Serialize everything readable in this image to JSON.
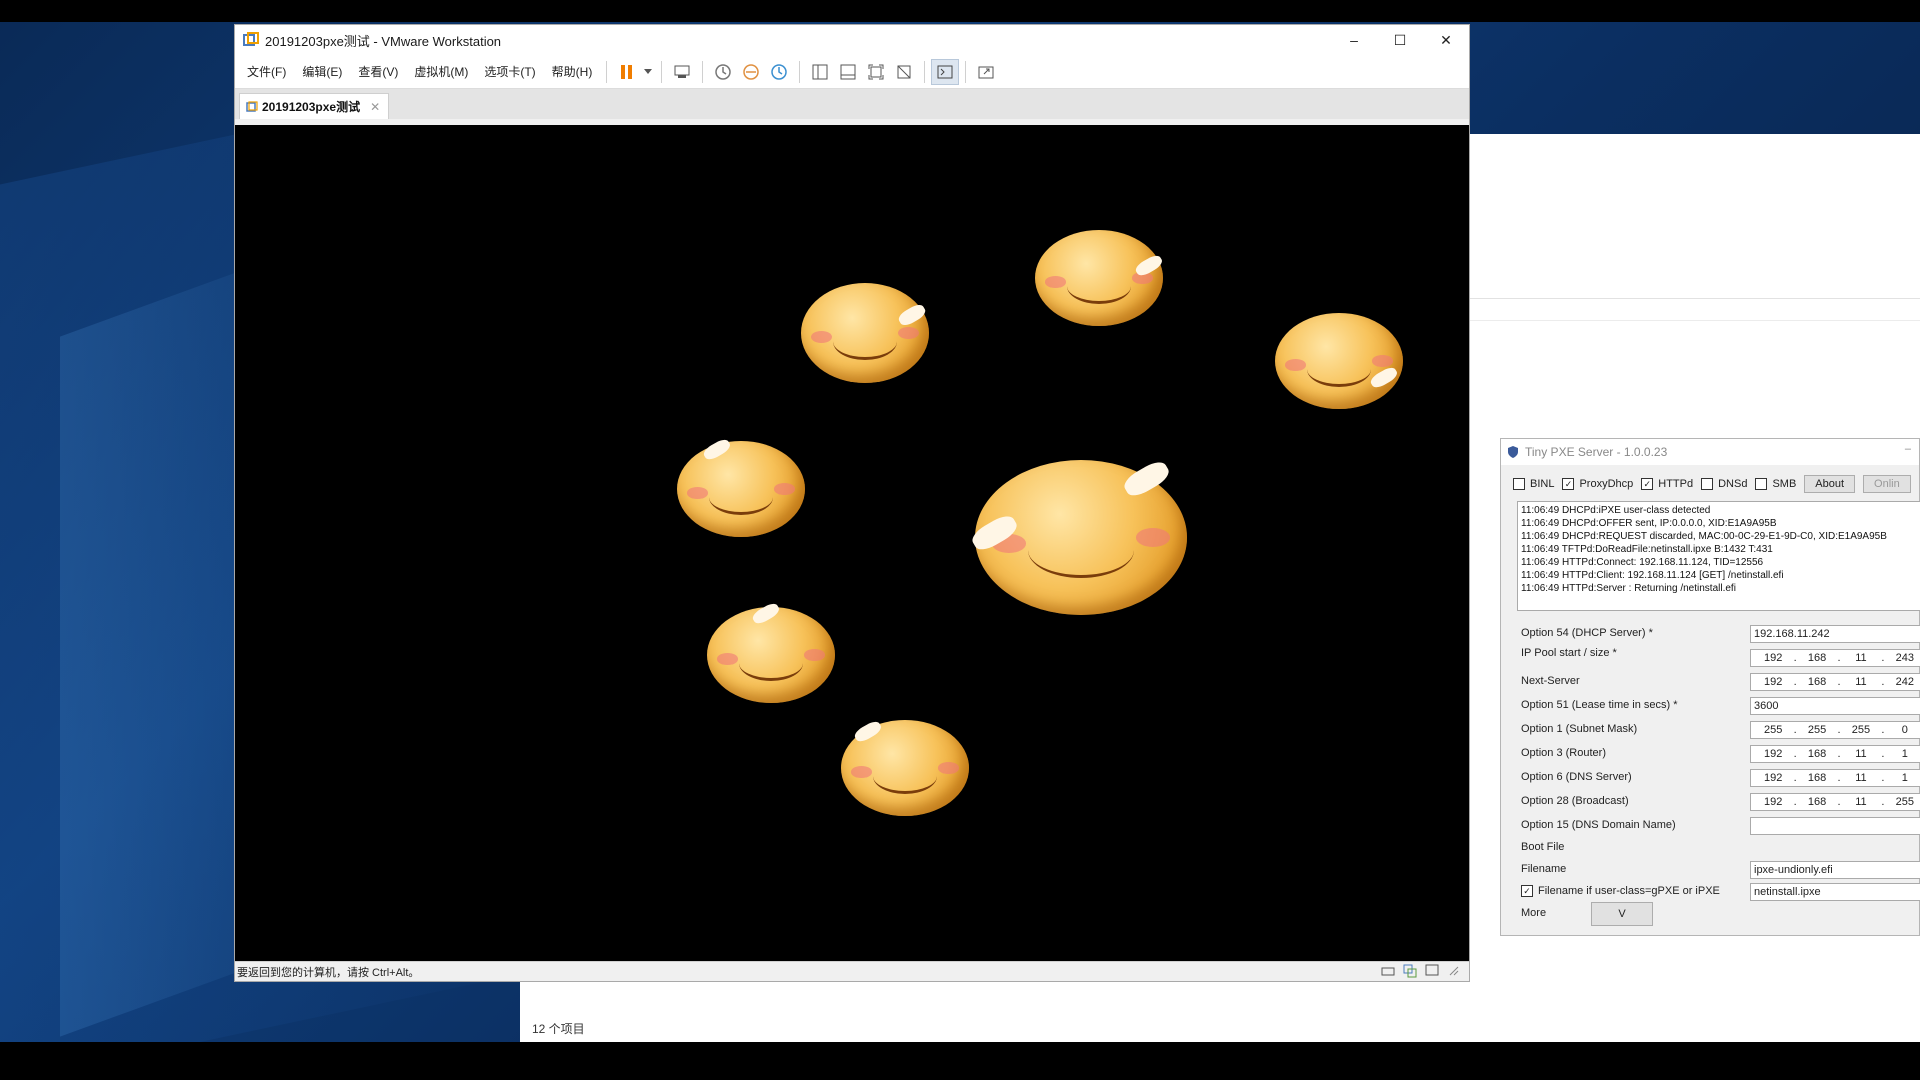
{
  "vmware": {
    "title": "20191203pxe测试 - VMware Workstation",
    "menu": [
      "文件(F)",
      "编辑(E)",
      "查看(V)",
      "虚拟机(M)",
      "选项卡(T)",
      "帮助(H)"
    ],
    "tab_label": "20191203pxe测试",
    "status_message": "要返回到您的计算机，请按 Ctrl+Alt。",
    "accent_color": "#f07d00"
  },
  "explorer": {
    "item_count": "12 个项目"
  },
  "pxe": {
    "title": "Tiny PXE Server - 1.0.0.23",
    "options": [
      {
        "label": "BINL",
        "checked": false
      },
      {
        "label": "ProxyDhcp",
        "checked": true
      },
      {
        "label": "HTTPd",
        "checked": true
      },
      {
        "label": "DNSd",
        "checked": false
      },
      {
        "label": "SMB",
        "checked": false
      }
    ],
    "about_label": "About",
    "online_label": "Onlin",
    "log": [
      "11:06:49 DHCPd:iPXE user-class detected",
      "11:06:49 DHCPd:OFFER sent, IP:0.0.0.0, XID:E1A9A95B",
      "11:06:49 DHCPd:REQUEST discarded, MAC:00-0C-29-E1-9D-C0, XID:E1A9A95B",
      "11:06:49 TFTPd:DoReadFile:netinstall.ipxe B:1432 T:431",
      "11:06:49 HTTPd:Connect: 192.168.11.124, TID=12556",
      "11:06:49 HTTPd:Client: 192.168.11.124 [GET] /netinstall.efi",
      "11:06:49 HTTPd:Server : Returning /netinstall.efi"
    ],
    "opt54_label": "Option 54 (DHCP Server) *",
    "opt54_value": "192.168.11.242",
    "pool_label": "IP Pool start / size *",
    "pool": [
      "192",
      "168",
      "11",
      "243"
    ],
    "next_label": "Next-Server",
    "next": [
      "192",
      "168",
      "11",
      "242"
    ],
    "opt51_label": "Option 51 (Lease time in secs) *",
    "opt51_value": "3600",
    "opt1_label": "Option 1  (Subnet Mask)",
    "opt1": [
      "255",
      "255",
      "255",
      "0"
    ],
    "opt3_label": "Option 3  (Router)",
    "opt3": [
      "192",
      "168",
      "11",
      "1"
    ],
    "opt6_label": "Option 6  (DNS Server)",
    "opt6": [
      "192",
      "168",
      "11",
      "1"
    ],
    "opt28_label": "Option 28 (Broadcast)",
    "opt28": [
      "192",
      "168",
      "11",
      "255"
    ],
    "opt15_label": "Option 15 (DNS Domain Name)",
    "opt15_value": "",
    "bootfile_label": "Boot File",
    "filename_label": "Filename",
    "filename_value": "ipxe-undionly.efi",
    "filename_ipxe_label": "Filename if user-class=gPXE or iPXE",
    "filename_ipxe_checked": true,
    "filename_ipxe_value": "netinstall.ipxe",
    "more_label": "More",
    "v_label": "V"
  }
}
